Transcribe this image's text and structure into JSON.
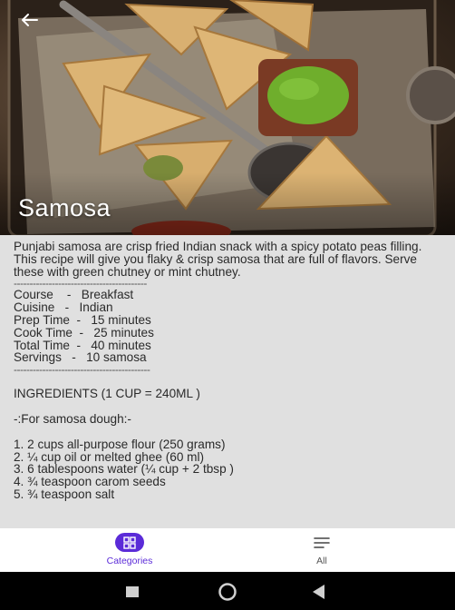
{
  "recipe": {
    "title": "Samosa",
    "description": "Punjabi samosa are crisp fried Indian snack with a spicy potato peas filling. This recipe will give you flaky & crisp samosa that are full of flavors. Serve these with green chutney or mint chutney.",
    "separator": "------------------------------------------",
    "details": [
      {
        "text": "Course    -   Breakfast"
      },
      {
        "text": "Cuisine   -   Indian"
      },
      {
        "text": "Prep Time  -   15 minutes"
      },
      {
        "text": "Cook Time  -   25 minutes"
      },
      {
        "text": "Total Time  -   40 minutes"
      },
      {
        "text": "Servings   -   10 samosa"
      }
    ],
    "separator2": "-------------------------------------------",
    "ingredients_heading": "INGREDIENTS (1 CUP = 240ML )",
    "dough_heading": "-:For samosa dough:-",
    "ingredients": [
      "1. 2 cups all-purpose flour (250 grams)",
      "2. ¼ cup oil or melted ghee (60 ml)",
      "3. 6 tablespoons water (¼ cup + 2 tbsp )",
      "4. ¾ teaspoon carom seeds",
      "5. ¾ teaspoon salt"
    ]
  },
  "nav": {
    "categories_label": "Categories",
    "all_label": "All",
    "active": "Categories"
  },
  "icons": {
    "back": "arrow-left-icon",
    "categories": "grid-icon",
    "all": "list-icon",
    "recents": "square-icon",
    "home": "circle-icon",
    "back_sys": "triangle-back-icon"
  },
  "colors": {
    "accent": "#5b2bd8",
    "content_bg": "#e0e0e0"
  }
}
